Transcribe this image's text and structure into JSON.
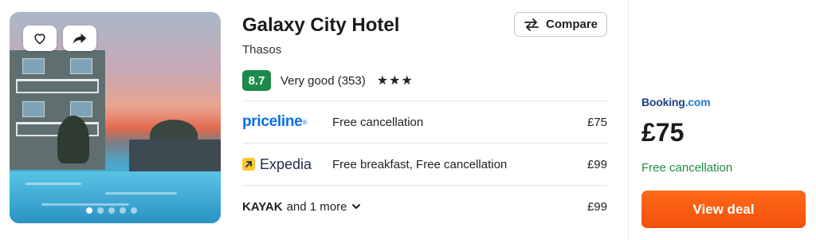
{
  "hotel": {
    "name": "Galaxy City Hotel",
    "location": "Thasos",
    "score": "8.7",
    "rating_text": "Very good (353)",
    "stars": "★★★"
  },
  "photo": {
    "slide_count": 5,
    "active_slide": 1,
    "favorite_icon": "heart-icon",
    "share_icon": "share-arrow-icon"
  },
  "compare": {
    "label": "Compare",
    "icon": "swap-arrows-icon"
  },
  "offers": [
    {
      "provider": "priceline",
      "description": "Free cancellation",
      "price": "£75"
    },
    {
      "provider": "Expedia",
      "description": "Free breakfast, Free cancellation",
      "price": "£99"
    }
  ],
  "more_offers": {
    "provider": "KAYAK",
    "more_text": "and 1 more",
    "price": "£99"
  },
  "best_deal": {
    "provider_main": "Booking",
    "provider_suffix": ".com",
    "price": "£75",
    "note": "Free cancellation",
    "cta": "View deal"
  },
  "colors": {
    "score_green": "#1d8a49",
    "cta_orange": "#f2500a",
    "priceline_blue": "#0a6ee6",
    "booking_navy": "#1c3f8a"
  }
}
